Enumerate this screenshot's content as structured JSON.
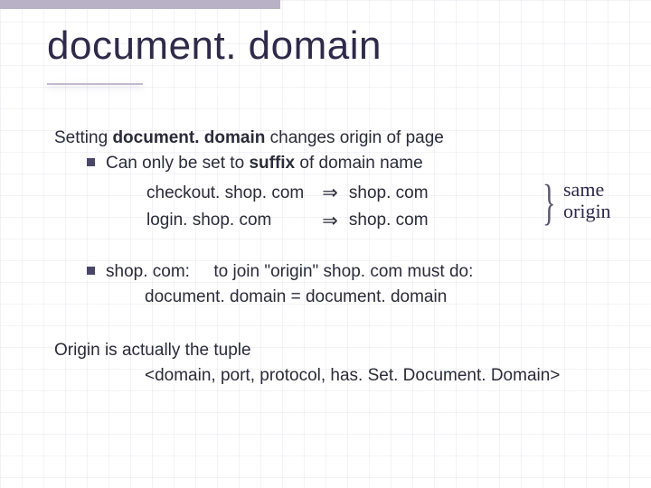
{
  "title": "document. domain",
  "p1": {
    "lead_a": "Setting  ",
    "lead_b": "document. domain",
    "lead_c": "  changes origin of page",
    "sub_a": "Can only be set to ",
    "sub_b": "suffix",
    "sub_c": " of domain name",
    "ex": [
      {
        "from": "checkout. shop. com",
        "arrow": "⇒",
        "to": "shop. com"
      },
      {
        "from": "login. shop. com",
        "arrow": "⇒",
        "to": "shop. com"
      }
    ],
    "annot1": "same",
    "annot2": "origin"
  },
  "p2": {
    "a": "shop. com:",
    "b": "to join \"origin\" shop. com must do:",
    "c": "document. domain = document. domain"
  },
  "p3": {
    "a": "Origin is actually the tuple",
    "b": "<domain, port, protocol, has. Set. Document. Domain>"
  }
}
